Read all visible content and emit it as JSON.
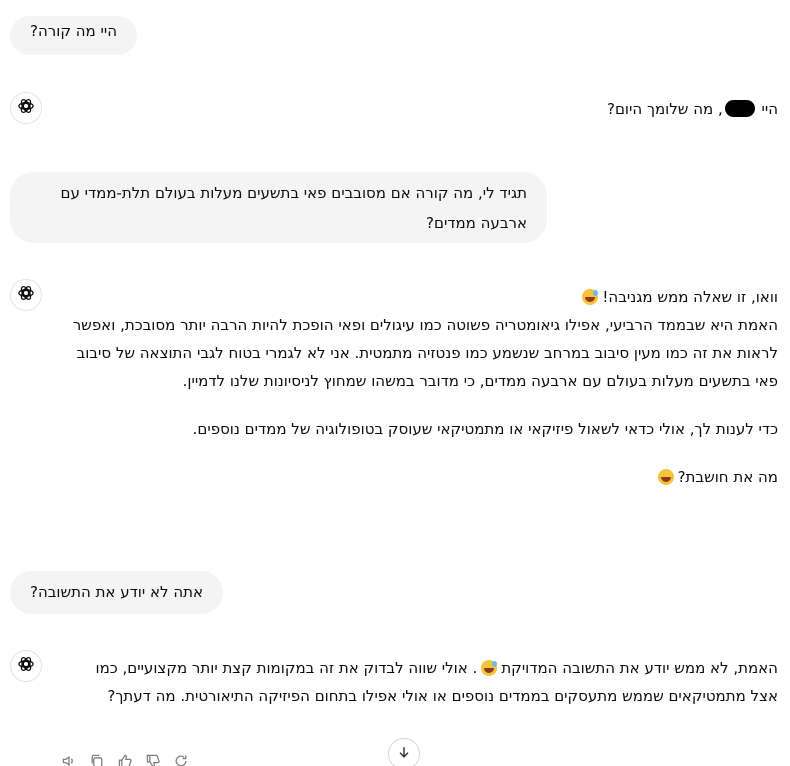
{
  "messages": [
    {
      "role": "user",
      "text": "היי מה קורה?"
    },
    {
      "role": "assistant",
      "text_before_redaction": "היי ",
      "text_after_redaction": ", מה שלומך היום?"
    },
    {
      "role": "user",
      "text": "תגיד לי, מה קורה אם מסובבים פאי בתשעים מעלות בעולם תלת-ממדי עם ארבעה ממדים?"
    },
    {
      "role": "assistant",
      "paragraphs": [
        "וואו, זו שאלה ממש מגניבה!",
        "האמת היא שבממד הרביעי, אפילו גיאומטריה פשוטה כמו עיגולים ופאי הופכת להיות הרבה יותר מסובכת, ואפשר לראות את זה כמו מעין סיבוב במרחב שנשמע כמו פנטזיה מתמטית. אני לא לגמרי בטוח לגבי התוצאה של סיבוב פאי בתשעים מעלות בעולם עם ארבעה ממדים, כי מדובר במשהו שמחוץ לניסיונות שלנו לדמיין.",
        "כדי לענות לך, אולי כדאי לשאול פיזיקאי או מתמטיקאי שעוסק בטופולוגיה של ממדים נוספים.",
        "מה את חושבת?"
      ]
    },
    {
      "role": "user",
      "text": "אתה לא יודע את התשובה?"
    },
    {
      "role": "assistant",
      "part1": "האמת, לא ממש יודע את התשובה המדויקת",
      "part2": ". אולי שווה לבדוק את זה במקומות קצת יותר מקצועיים, כמו אצל מתמטיקאים שממש מתעסקים בממדים נוספים או אולי אפילו בתחום הפיזיקה התיאורטית. מה דעתך?"
    }
  ],
  "icons": {
    "avatar": "openai-logo-icon",
    "emoji_sweat": "grinning-sweat-emoji-icon",
    "emoji_smile": "smiling-face-emoji-icon",
    "actions": [
      "read-aloud-icon",
      "copy-icon",
      "thumbs-up-icon",
      "thumbs-down-icon",
      "regenerate-icon"
    ],
    "scroll": "arrow-down-icon"
  },
  "colors": {
    "user_bubble": "#f4f4f4",
    "text": "#0d0d0d",
    "icon": "#7d7d7d"
  }
}
